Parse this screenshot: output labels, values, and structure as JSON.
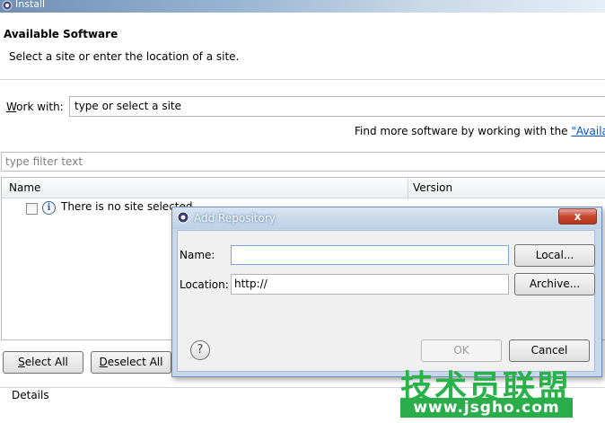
{
  "window": {
    "title": "Install"
  },
  "banner": {
    "title": "Available Software",
    "description": "Select a site or enter the location of a site."
  },
  "work_with": {
    "label_accel": "W",
    "label_rest": "ork with:",
    "value": "type or select a site"
  },
  "find_more": {
    "text": "Find more software by working with the ",
    "link": "\"Availab"
  },
  "filter": {
    "placeholder": "type filter text"
  },
  "table": {
    "columns": [
      "Name",
      "Version"
    ],
    "rows": [
      {
        "text": "There is no site selected."
      }
    ]
  },
  "buttons": {
    "select_all_accel": "S",
    "select_all_rest": "elect All",
    "deselect_all_accel": "D",
    "deselect_all_rest": "eselect All"
  },
  "details": {
    "label": "Details"
  },
  "dialog": {
    "title": "Add Repository",
    "close": "x",
    "name_label": "Name:",
    "name_value": "",
    "local_button": "Local...",
    "location_label": "Location:",
    "location_value": "http://",
    "archive_button": "Archive...",
    "help": "?",
    "ok_button": "OK",
    "cancel_button": "Cancel"
  },
  "watermark": {
    "brand": "技术员联盟",
    "url": "www.jsgho.com"
  }
}
